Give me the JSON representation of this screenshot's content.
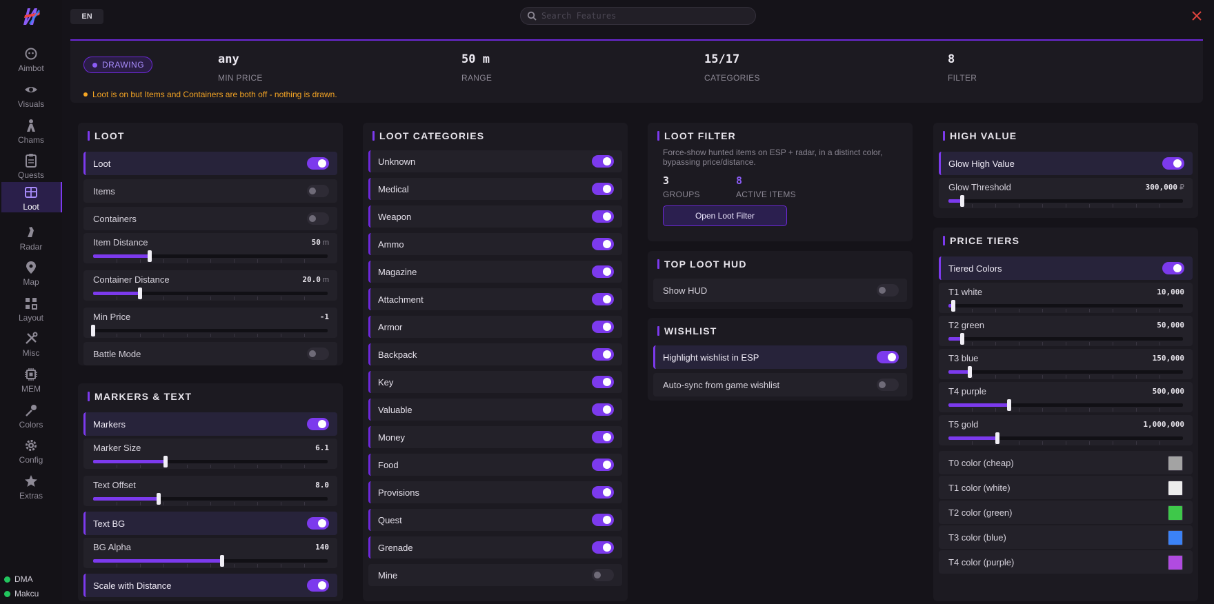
{
  "sidebar": {
    "items": [
      {
        "label": "Aimbot",
        "icon": "aimbot-icon"
      },
      {
        "label": "Visuals",
        "icon": "eye-icon"
      },
      {
        "label": "Chams",
        "icon": "chams-icon"
      },
      {
        "label": "Quests",
        "icon": "clipboard-icon"
      },
      {
        "label": "Loot",
        "icon": "loot-box-icon",
        "active": true
      },
      {
        "label": "Radar",
        "icon": "radar-icon"
      },
      {
        "label": "Map",
        "icon": "map-pin-icon"
      },
      {
        "label": "Layout",
        "icon": "layout-grid-icon"
      },
      {
        "label": "Misc",
        "icon": "tools-icon"
      },
      {
        "label": "MEM",
        "icon": "chip-icon"
      },
      {
        "label": "Colors",
        "icon": "brush-icon"
      },
      {
        "label": "Config",
        "icon": "gear-icon"
      },
      {
        "label": "Extras",
        "icon": "star-icon"
      }
    ],
    "status": [
      {
        "label": "DMA",
        "color": "#22c55e"
      },
      {
        "label": "Makcu",
        "color": "#22c55e"
      }
    ]
  },
  "topbar": {
    "lang": "EN",
    "search_placeholder": "Search Features"
  },
  "summary": {
    "state": "DRAWING",
    "stats": [
      {
        "value": "any",
        "label": "MIN PRICE"
      },
      {
        "value": "50 m",
        "label": "RANGE"
      },
      {
        "value": "15/17",
        "label": "CATEGORIES"
      },
      {
        "value": "8",
        "label": "FILTER"
      }
    ],
    "warning": "Loot is on but Items and Containers are both off - nothing is drawn."
  },
  "loot": {
    "title": "LOOT",
    "loot_label": "Loot",
    "loot_on": true,
    "items_label": "Items",
    "items_on": false,
    "containers_label": "Containers",
    "containers_on": false,
    "item_distance": {
      "label": "Item Distance",
      "value": "50",
      "unit": "m",
      "fraction": 0.24
    },
    "container_distance": {
      "label": "Container Distance",
      "value": "20.0",
      "unit": "m",
      "fraction": 0.2
    },
    "min_price": {
      "label": "Min Price",
      "value": "-1",
      "fraction": 0.0
    },
    "battle_label": "Battle Mode",
    "battle_on": false
  },
  "markers": {
    "title": "MARKERS & TEXT",
    "markers_label": "Markers",
    "markers_on": true,
    "marker_size": {
      "label": "Marker Size",
      "value": "6.1",
      "fraction": 0.31
    },
    "text_offset": {
      "label": "Text Offset",
      "value": "8.0",
      "fraction": 0.28
    },
    "text_bg_label": "Text BG",
    "text_bg_on": true,
    "bg_alpha": {
      "label": "BG Alpha",
      "value": "140",
      "fraction": 0.55
    },
    "scale_label": "Scale with Distance",
    "scale_on": true
  },
  "categories": {
    "title": "LOOT CATEGORIES",
    "items": [
      {
        "label": "Unknown",
        "on": true
      },
      {
        "label": "Medical",
        "on": true
      },
      {
        "label": "Weapon",
        "on": true
      },
      {
        "label": "Ammo",
        "on": true
      },
      {
        "label": "Magazine",
        "on": true
      },
      {
        "label": "Attachment",
        "on": true
      },
      {
        "label": "Armor",
        "on": true
      },
      {
        "label": "Backpack",
        "on": true
      },
      {
        "label": "Key",
        "on": true
      },
      {
        "label": "Valuable",
        "on": true
      },
      {
        "label": "Money",
        "on": true
      },
      {
        "label": "Food",
        "on": true
      },
      {
        "label": "Provisions",
        "on": true
      },
      {
        "label": "Quest",
        "on": true
      },
      {
        "label": "Grenade",
        "on": true
      },
      {
        "label": "Mine",
        "on": false
      }
    ]
  },
  "loot_filter": {
    "title": "LOOT FILTER",
    "description": "Force-show hunted items on ESP + radar, in a distinct color, bypassing price/distance.",
    "groups_value": "3",
    "groups_label": "GROUPS",
    "active_value": "8",
    "active_label": "ACTIVE ITEMS",
    "button": "Open Loot Filter"
  },
  "top_loot_hud": {
    "title": "TOP LOOT HUD",
    "show_label": "Show HUD",
    "show_on": false
  },
  "wishlist": {
    "title": "WISHLIST",
    "highlight_label": "Highlight wishlist in ESP",
    "highlight_on": true,
    "autosync_label": "Auto-sync from game wishlist",
    "autosync_on": false
  },
  "high_value": {
    "title": "HIGH VALUE",
    "glow_label": "Glow High Value",
    "glow_on": true,
    "threshold": {
      "label": "Glow Threshold",
      "value": "300,000",
      "unit": "₽",
      "fraction": 0.06
    }
  },
  "price_tiers": {
    "title": "PRICE TIERS",
    "tiered_label": "Tiered Colors",
    "tiered_on": true,
    "tiers": [
      {
        "label": "T1 white",
        "value": "10,000",
        "fraction": 0.02
      },
      {
        "label": "T2 green",
        "value": "50,000",
        "fraction": 0.06
      },
      {
        "label": "T3 blue",
        "value": "150,000",
        "fraction": 0.09
      },
      {
        "label": "T4 purple",
        "value": "500,000",
        "fraction": 0.26
      },
      {
        "label": "T5 gold",
        "value": "1,000,000",
        "fraction": 0.21
      }
    ],
    "colors": [
      {
        "label": "T0 color (cheap)",
        "color": "#a3a3a3"
      },
      {
        "label": "T1 color (white)",
        "color": "#ececec"
      },
      {
        "label": "T2 color (green)",
        "color": "#3ec84a"
      },
      {
        "label": "T3 color (blue)",
        "color": "#3b82f6"
      },
      {
        "label": "T4 color (purple)",
        "color": "#b04be0"
      }
    ]
  }
}
